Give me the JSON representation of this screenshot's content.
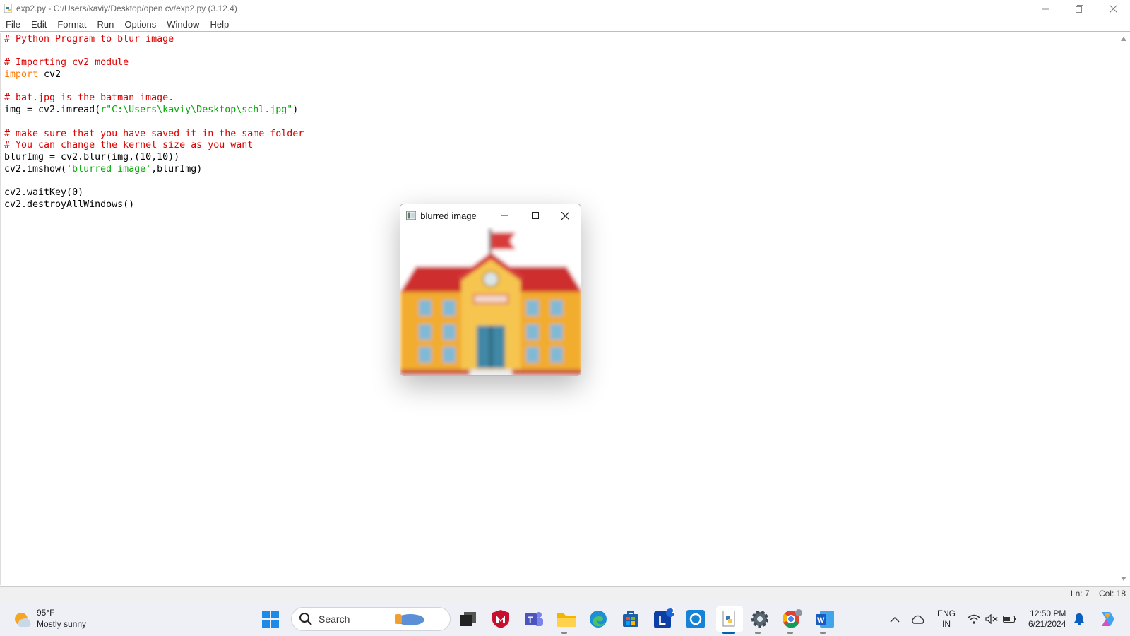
{
  "window": {
    "title": "exp2.py - C:/Users/kaviy/Desktop/open cv/exp2.py (3.12.4)"
  },
  "menu": [
    "File",
    "Edit",
    "Format",
    "Run",
    "Options",
    "Window",
    "Help"
  ],
  "code_lines": [
    [
      {
        "t": "# Python Program to blur image",
        "c": "comment"
      }
    ],
    [],
    [
      {
        "t": "# Importing cv2 module",
        "c": "comment"
      }
    ],
    [
      {
        "t": "import",
        "c": "kw"
      },
      {
        "t": " cv2",
        "c": ""
      }
    ],
    [],
    [
      {
        "t": "# bat.jpg is the batman image.",
        "c": "comment"
      }
    ],
    [
      {
        "t": "img = cv2.imread(",
        "c": ""
      },
      {
        "t": "r\"C:\\Users\\kaviy\\Desktop\\schl.jpg\"",
        "c": "str"
      },
      {
        "t": ")",
        "c": ""
      }
    ],
    [],
    [
      {
        "t": "# make sure that you have saved it in the same folder",
        "c": "comment"
      }
    ],
    [
      {
        "t": "# You can change the kernel size as you want",
        "c": "comment"
      }
    ],
    [
      {
        "t": "blurImg = cv2.blur(img,(10,10))",
        "c": ""
      }
    ],
    [
      {
        "t": "cv2.imshow(",
        "c": ""
      },
      {
        "t": "'blurred image'",
        "c": "str"
      },
      {
        "t": ",blurImg)",
        "c": ""
      }
    ],
    [],
    [
      {
        "t": "cv2.waitKey(0)",
        "c": ""
      }
    ],
    [
      {
        "t": "cv2.destroyAllWindows()",
        "c": ""
      }
    ]
  ],
  "status": {
    "line": "Ln: 7",
    "col": "Col: 18"
  },
  "popup": {
    "title": "blurred image"
  },
  "taskbar": {
    "weather_temp": "95°F",
    "weather_desc": "Mostly sunny",
    "search_label": "Search",
    "lang_top": "ENG",
    "lang_bottom": "IN",
    "time": "12:50 PM",
    "date": "6/21/2024",
    "store_badge": "1"
  },
  "colors": {
    "comment": "#dd0000",
    "keyword": "#ff7700",
    "string": "#00aa00",
    "accent": "#005fb8"
  }
}
